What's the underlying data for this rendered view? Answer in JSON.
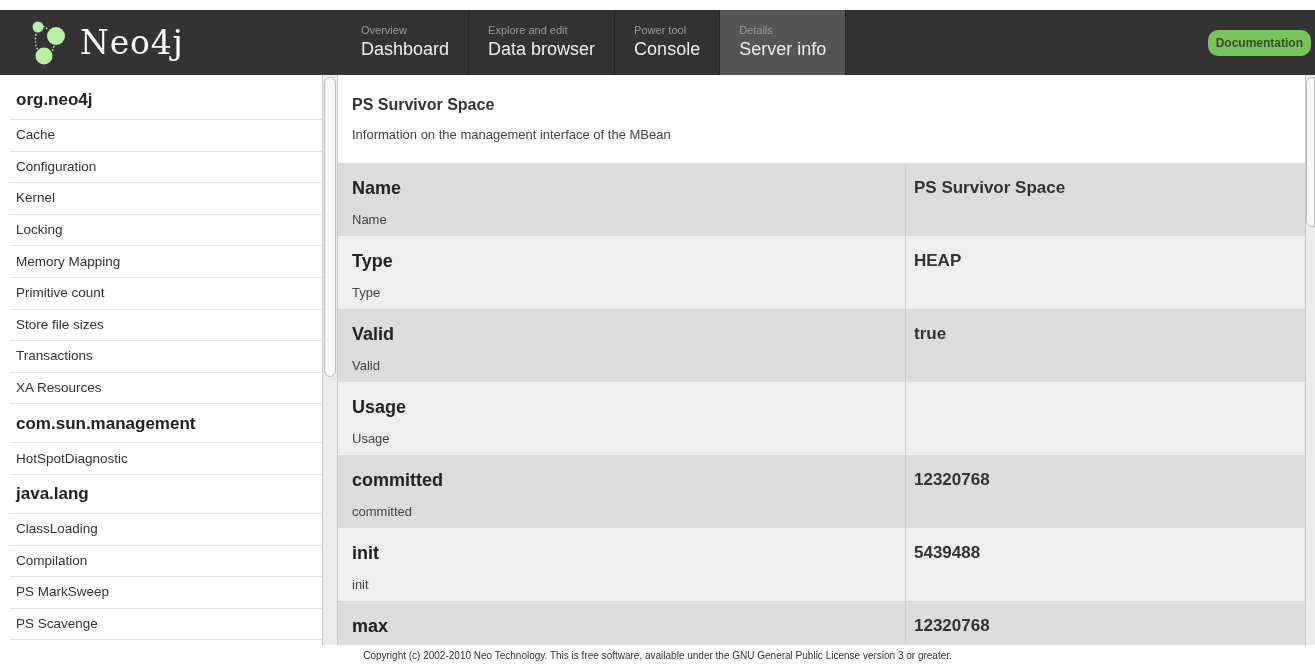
{
  "logo": {
    "text": "Neo4j"
  },
  "nav": [
    {
      "caption": "Overview",
      "label": "Dashboard",
      "selected": false
    },
    {
      "caption": "Explore and edit",
      "label": "Data browser",
      "selected": false
    },
    {
      "caption": "Power tool",
      "label": "Console",
      "selected": false
    },
    {
      "caption": "Details",
      "label": "Server info",
      "selected": true
    }
  ],
  "documentation_button": "Documentation",
  "sidebar": {
    "items": [
      {
        "kind": "group",
        "label": "org.neo4j"
      },
      {
        "kind": "item",
        "label": "Cache"
      },
      {
        "kind": "item",
        "label": "Configuration"
      },
      {
        "kind": "item",
        "label": "Kernel"
      },
      {
        "kind": "item",
        "label": "Locking"
      },
      {
        "kind": "item",
        "label": "Memory Mapping"
      },
      {
        "kind": "item",
        "label": "Primitive count"
      },
      {
        "kind": "item",
        "label": "Store file sizes"
      },
      {
        "kind": "item",
        "label": "Transactions"
      },
      {
        "kind": "item",
        "label": "XA Resources"
      },
      {
        "kind": "group",
        "label": "com.sun.management"
      },
      {
        "kind": "item",
        "label": "HotSpotDiagnostic"
      },
      {
        "kind": "group",
        "label": "java.lang"
      },
      {
        "kind": "item",
        "label": "ClassLoading"
      },
      {
        "kind": "item",
        "label": "Compilation"
      },
      {
        "kind": "item",
        "label": "PS MarkSweep"
      },
      {
        "kind": "item",
        "label": "PS Scavenge"
      }
    ]
  },
  "bean": {
    "title": "PS Survivor Space",
    "description": "Information on the management interface of the MBean",
    "rows": [
      {
        "name": "Name",
        "description": "Name",
        "value": "PS Survivor Space"
      },
      {
        "name": "Type",
        "description": "Type",
        "value": "HEAP"
      },
      {
        "name": "Valid",
        "description": "Valid",
        "value": "true"
      },
      {
        "name": "Usage",
        "description": "Usage"
      },
      {
        "name": "committed",
        "description": "committed",
        "value": "12320768"
      },
      {
        "name": "init",
        "description": "init",
        "value": "5439488"
      },
      {
        "name": "max",
        "value": "12320768"
      }
    ]
  },
  "footer": "Copyright (c) 2002-2010 Neo Technology. This is free software, available under the GNU General Public License version 3 or greater."
}
